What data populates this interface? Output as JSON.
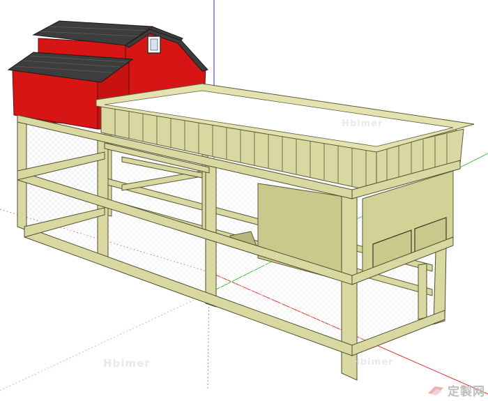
{
  "watermarks": {
    "main": "Hbimer",
    "coop_left": "Hbimer",
    "coop_right": "Hbimer"
  },
  "brand": {
    "text": "定製网",
    "logo_icon": "red-wing-logo-icon"
  },
  "colors": {
    "background": "#ffffff",
    "axis_red": "#d9302a",
    "axis_green": "#3cc23c",
    "axis_blue": "#2a2ad9",
    "frame_wood": "#d9d8a0",
    "panel_wood": "#c9c98c",
    "barn_red": "#d81515",
    "roof_shingle": "#3d3d3d",
    "mesh": "#e6e6e6"
  }
}
